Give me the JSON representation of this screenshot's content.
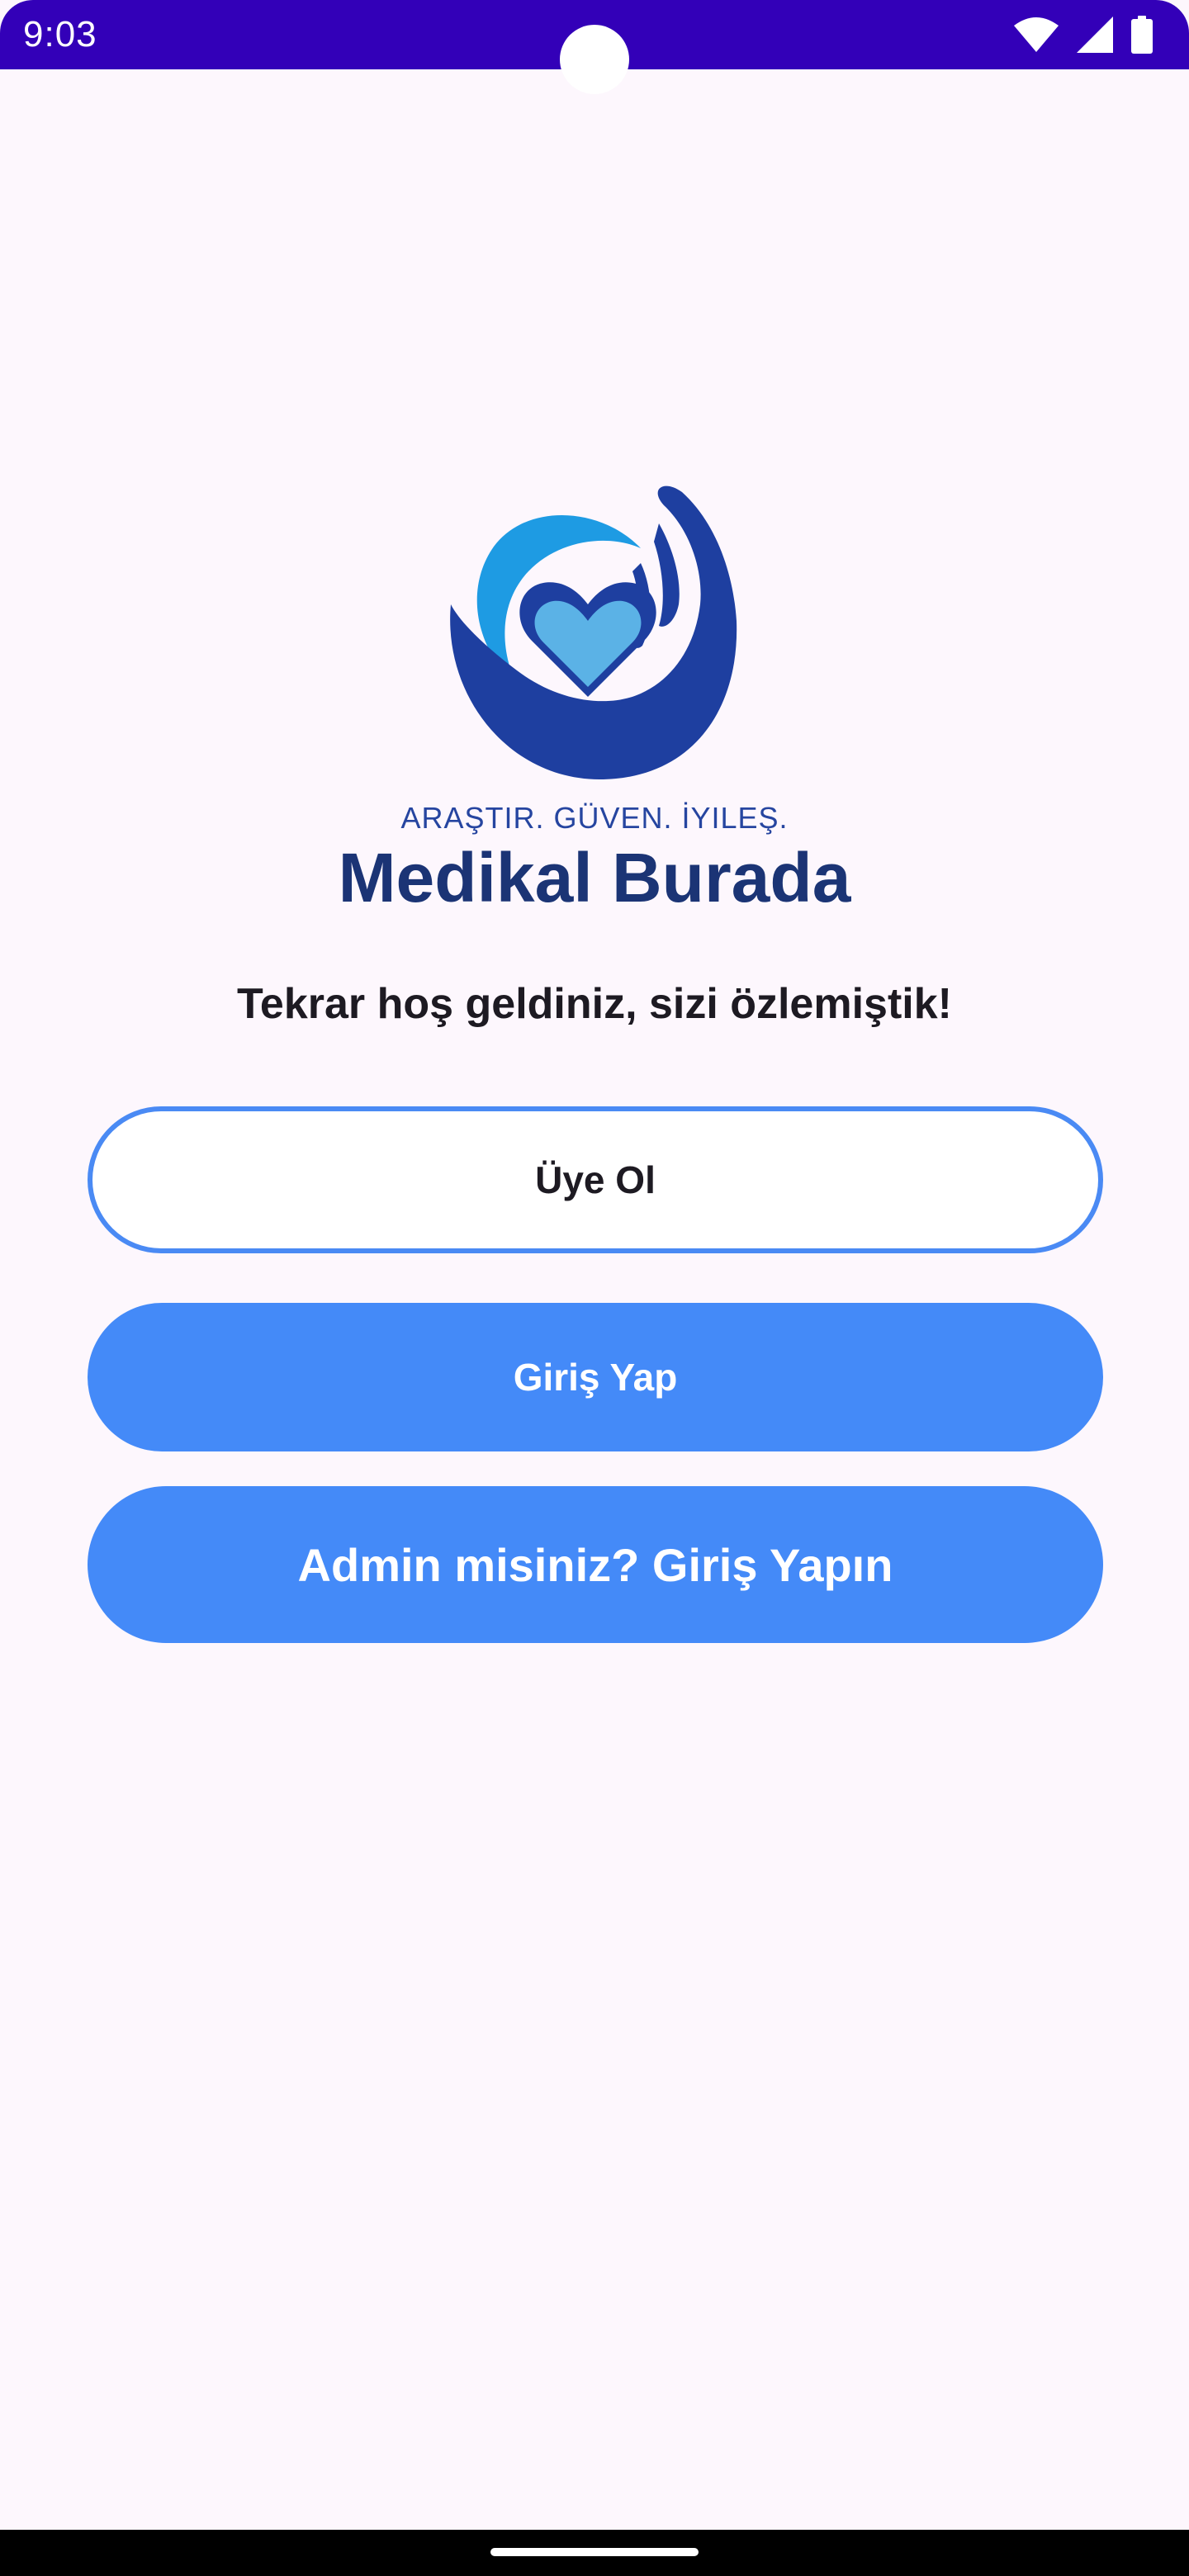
{
  "status_bar": {
    "time": "9:03",
    "icons": [
      "wifi-icon",
      "cell-signal-icon",
      "battery-icon"
    ],
    "background": "#3300b8"
  },
  "brand": {
    "tagline": "ARAŞTIR. GÜVEN. İYILEŞ.",
    "name": "Medikal Burada",
    "logo_icon": "hands-heart-logo"
  },
  "welcome_text": "Tekrar hoş geldiniz, sizi özlemiştik!",
  "buttons": {
    "register": "Üye Ol",
    "login": "Giriş Yap",
    "admin_login": "Admin misiniz? Giriş Yapın"
  },
  "colors": {
    "accent": "#448af8",
    "brand_dark": "#1b3475",
    "background": "#fdf7fd"
  }
}
